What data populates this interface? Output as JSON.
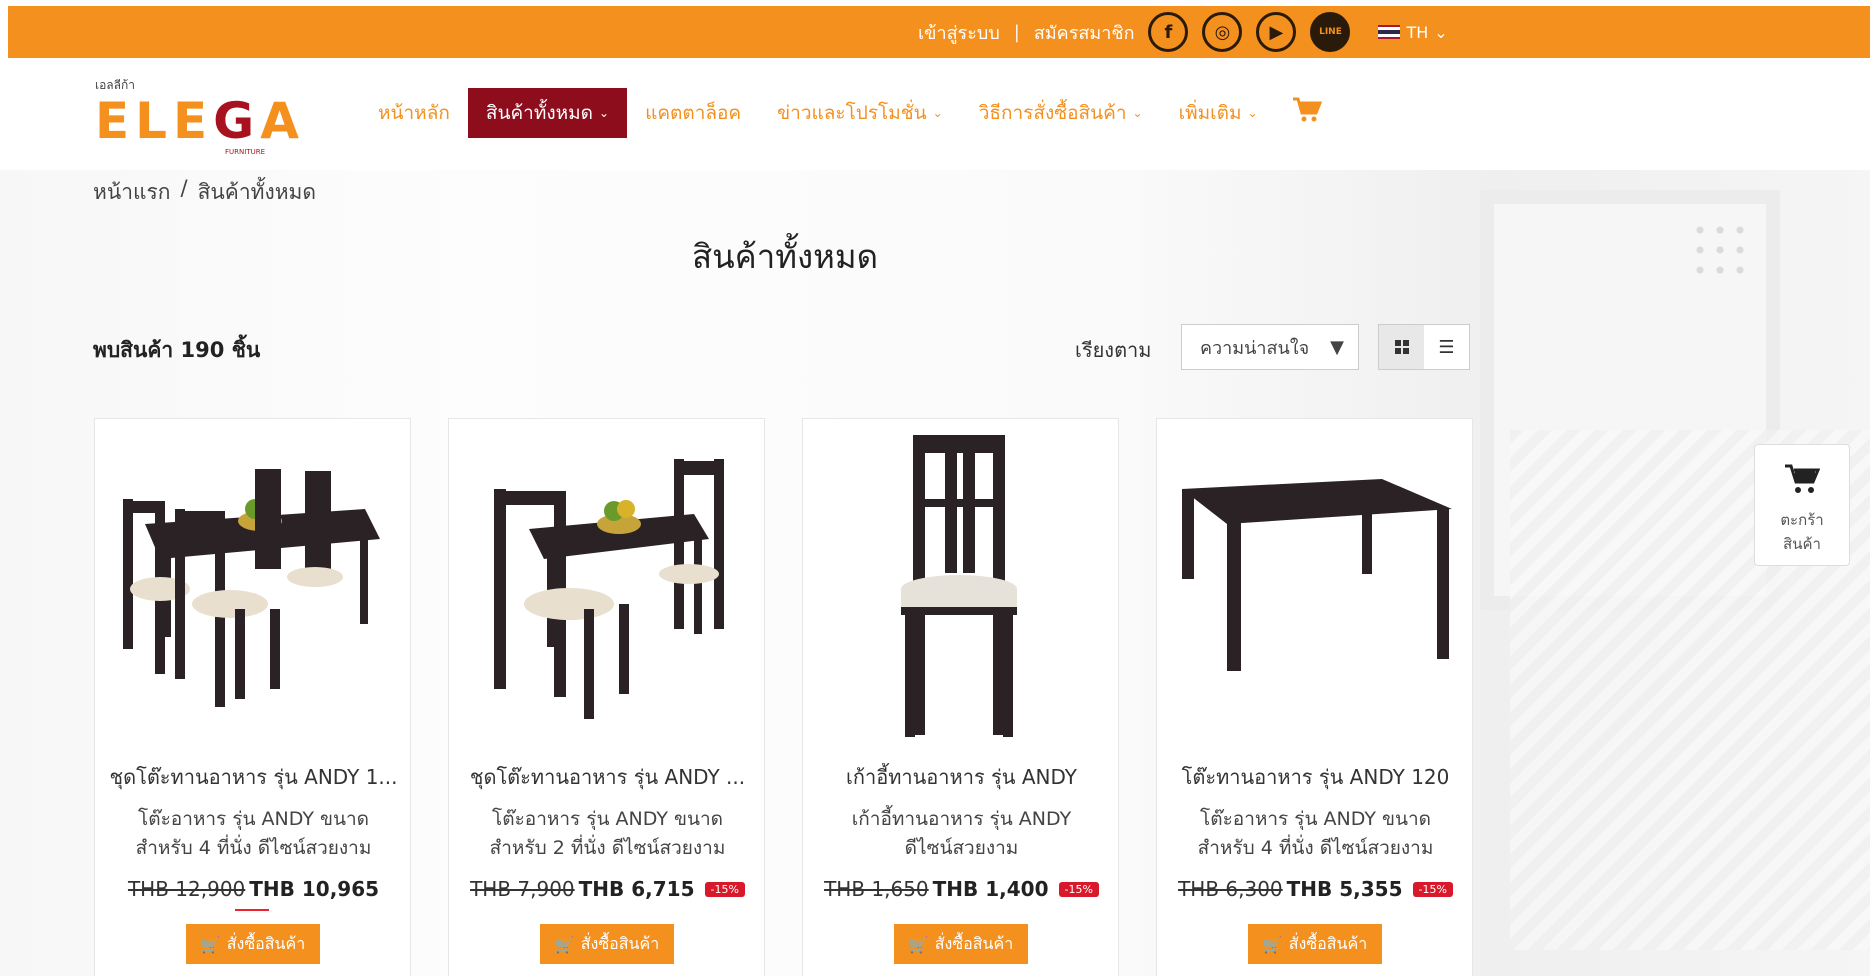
{
  "topbar": {
    "login": "เข้าสู่ระบบ",
    "separator": "|",
    "register": "สมัครสมาชิก",
    "social": [
      {
        "icon": "facebook-icon",
        "glyph": "f"
      },
      {
        "icon": "instagram-icon",
        "glyph": "◎"
      },
      {
        "icon": "youtube-icon",
        "glyph": "▶"
      },
      {
        "icon": "line-icon",
        "glyph": "LINE"
      }
    ],
    "language": "TH"
  },
  "header": {
    "logo_small": "เอลลีก้า",
    "logo_word_1": "ELE",
    "logo_word_g": "G",
    "logo_word_2": "A",
    "logo_sub": "FURNITURE",
    "nav": [
      {
        "label": "หน้าหลัก",
        "dropdown": false,
        "active": false
      },
      {
        "label": "สินค้าทั้งหมด",
        "dropdown": true,
        "active": true
      },
      {
        "label": "แคตตาล็อค",
        "dropdown": false,
        "active": false
      },
      {
        "label": "ข่าวและโปรโมชั่น",
        "dropdown": true,
        "active": false
      },
      {
        "label": "วิธีการสั่งซื้อสินค้า",
        "dropdown": true,
        "active": false
      },
      {
        "label": "เพิ่มเติม",
        "dropdown": true,
        "active": false
      }
    ]
  },
  "breadcrumb": {
    "home": "หน้าแรก",
    "separator": "/",
    "current": "สินค้าทั้งหมด"
  },
  "page": {
    "title": "สินค้าทั้งหมด",
    "found": "พบสินค้า 190 ชิ้น",
    "sort_label": "เรียงตาม",
    "sort_value": "ความน่าสนใจ"
  },
  "products": [
    {
      "name": "ชุดโต๊ะทานอาหาร รุ่น ANDY 1...",
      "desc_line1": "โต๊ะอาหาร รุ่น ANDY ขนาด",
      "desc_line2": "สำหรับ 4 ที่นั่ง ดีไซน์สวยงาม",
      "old_price": "THB 12,900",
      "new_price": "THB 10,965",
      "badge": "",
      "buy": "สั่งซื้อสินค้า",
      "image": "dining-set-4"
    },
    {
      "name": "ชุดโต๊ะทานอาหาร รุ่น ANDY ...",
      "desc_line1": "โต๊ะอาหาร รุ่น ANDY ขนาด",
      "desc_line2": "สำหรับ 2 ที่นั่ง ดีไซน์สวยงาม",
      "old_price": "THB 7,900",
      "new_price": "THB 6,715",
      "badge": "-15%",
      "buy": "สั่งซื้อสินค้า",
      "image": "dining-set-2"
    },
    {
      "name": "เก้าอี้ทานอาหาร รุ่น ANDY",
      "desc_line1": "เก้าอี้ทานอาหาร รุ่น ANDY",
      "desc_line2": "ดีไซน์สวยงาม",
      "old_price": "THB 1,650",
      "new_price": "THB 1,400",
      "badge": "-15%",
      "buy": "สั่งซื้อสินค้า",
      "image": "chair"
    },
    {
      "name": "โต๊ะทานอาหาร รุ่น ANDY 120",
      "desc_line1": "โต๊ะอาหาร รุ่น ANDY ขนาด",
      "desc_line2": "สำหรับ 4 ที่นั่ง ดีไซน์สวยงาม",
      "old_price": "THB 6,300",
      "new_price": "THB 5,355",
      "badge": "-15%",
      "buy": "สั่งซื้อสินค้า",
      "image": "table"
    }
  ],
  "float_cart": {
    "line1": "ตะกร้า",
    "line2": "สินค้า"
  },
  "colors": {
    "brand_orange": "#f4901e",
    "brand_red": "#8e0d1d",
    "badge_red": "#d8192b"
  }
}
